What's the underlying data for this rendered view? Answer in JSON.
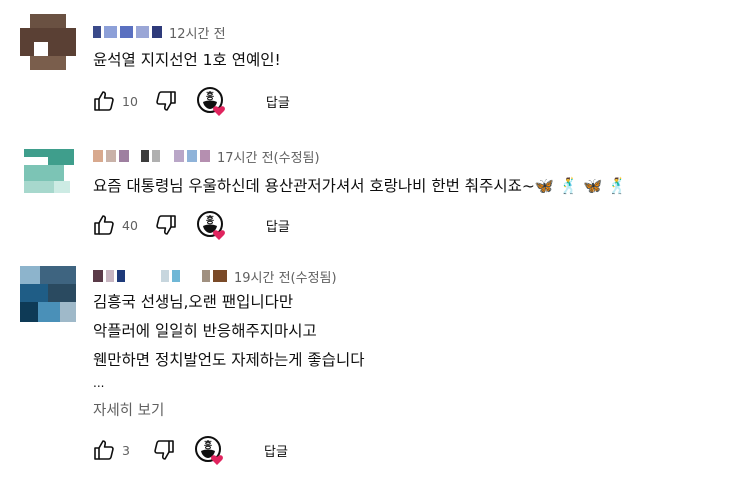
{
  "comments": [
    {
      "time": "12시간 전",
      "lines": [
        "윤석열 지지선언 1호 연예인!"
      ],
      "likes": "10",
      "reply_label": "답글"
    },
    {
      "time": "17시간 전(수정됨)",
      "lines": [
        "요즘 대통령님 우울하신데 용산관저가셔서 호랑나비 한번 춰주시죠~🦋 🕺 🦋 🕺"
      ],
      "likes": "40",
      "reply_label": "답글"
    },
    {
      "time": "19시간 전(수정됨)",
      "lines": [
        "김흥국 선생님,오랜 팬입니다만",
        "악플러에 일일히 반응해주지마시고",
        "웬만하면 정치발언도 자제하는게 좋습니다"
      ],
      "ellipsis": "...",
      "read_more": "자세히 보기",
      "likes": "3",
      "reply_label": "답글"
    }
  ],
  "icons": {
    "like": "thumbs-up-icon",
    "dislike": "thumbs-down-icon",
    "creator_heart": "creator-heart-icon"
  },
  "colors": {
    "text": "#0f0f0f",
    "secondary": "#606060",
    "heart": "#e0245e"
  }
}
